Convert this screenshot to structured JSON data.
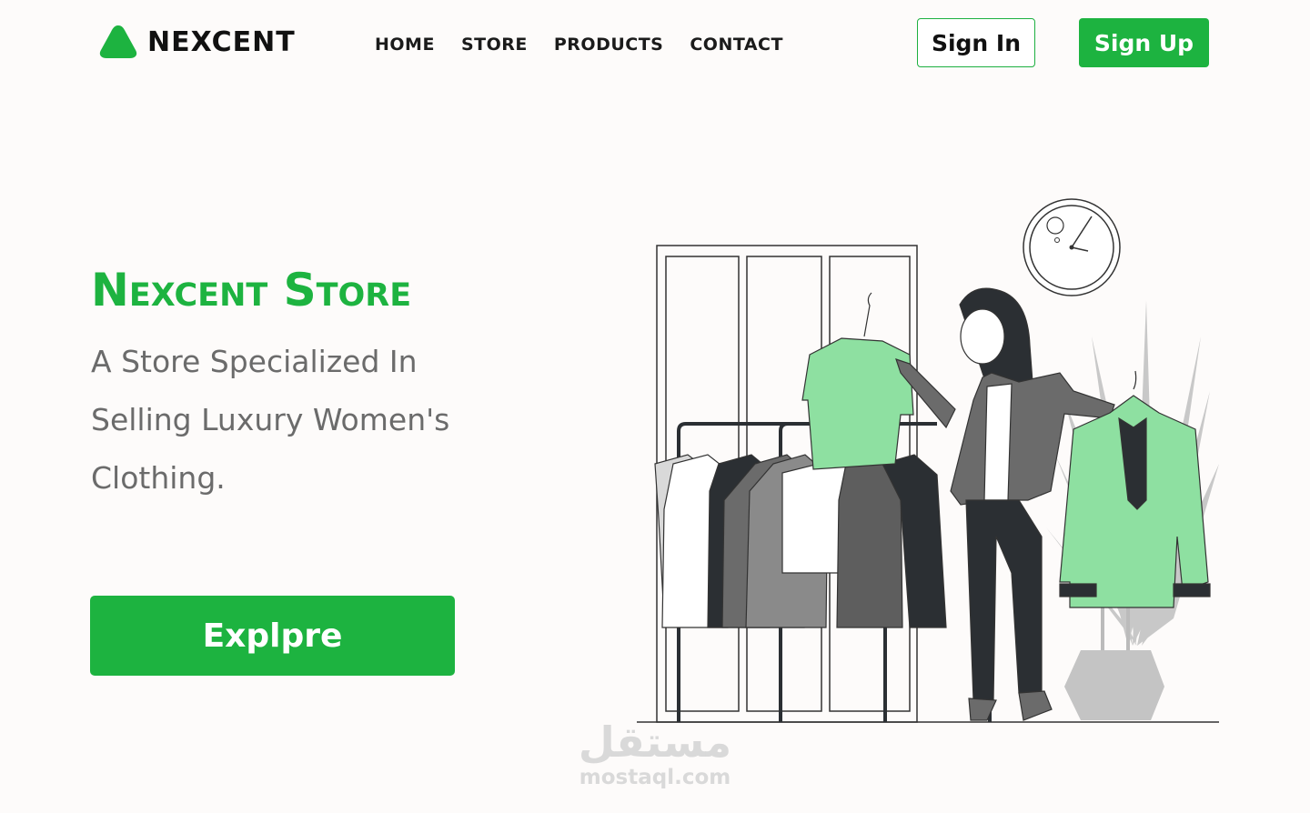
{
  "brand": {
    "name": "NEXCENT",
    "accent_color": "#1db340",
    "logo_icon": "triangle-logo-icon"
  },
  "nav": {
    "items": [
      {
        "label": "HOME"
      },
      {
        "label": "STORE"
      },
      {
        "label": "PRODUCTS"
      },
      {
        "label": "CONTACT"
      }
    ]
  },
  "auth": {
    "sign_in_label": "Sign In",
    "sign_up_label": "Sign Up"
  },
  "hero": {
    "title": "Nexcent Store",
    "subtitle": "A Store Specialized In Selling Luxury Women's Clothing.",
    "cta_label": "Explpre"
  },
  "illustration": {
    "icon": "woman-shopping-clothes-illustration"
  },
  "watermark": {
    "logo_text": "مستقل",
    "url_text": "mostaql.com"
  }
}
